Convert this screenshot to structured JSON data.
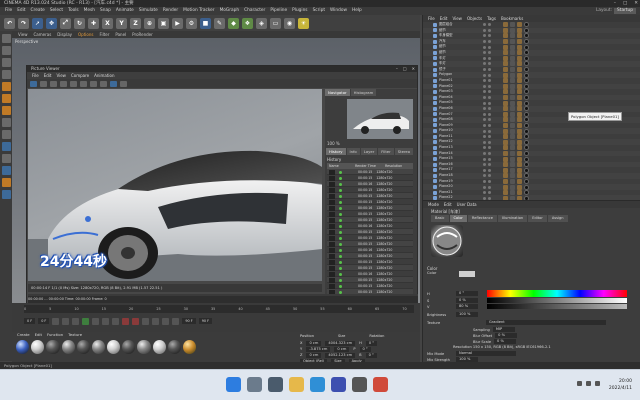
{
  "app": {
    "window_title": "CINEMA 4D R13.024 Studio (RC - R13) - [汽车.c4d *] - 主要"
  },
  "menubar": {
    "items": [
      "File",
      "Edit",
      "Create",
      "Select",
      "Tools",
      "Mesh",
      "Snap",
      "Animate",
      "Simulate",
      "Render",
      "Motion Tracker",
      "MoGraph",
      "Character",
      "Pipeline",
      "Plugins",
      "Script",
      "Window",
      "Help"
    ],
    "layout_label": "Layout:",
    "layout_value": "Startup"
  },
  "toolbar": {
    "buttons": [
      "undo-button",
      "redo-button",
      "live-select-button",
      "move-button",
      "scale-button",
      "rotate-button",
      "recent-button",
      "x-axis-button",
      "y-axis-button",
      "z-axis-button",
      "world-coord-button",
      "render-view-button",
      "render-picture-button",
      "edit-render-settings-button",
      "cube-button",
      "pen-button",
      "subdivision-button",
      "array-button",
      "deformer-button",
      "floor-button",
      "camera-button",
      "light-button"
    ],
    "axis_labels": [
      "X",
      "Y",
      "Z"
    ]
  },
  "viewport": {
    "menu": [
      "View",
      "Cameras",
      "Display",
      "Options",
      "Filter",
      "Panel",
      "ProRender"
    ],
    "active_menu": "Options",
    "label": "Perspective"
  },
  "picture_viewer": {
    "title": "Picture Viewer",
    "menu": [
      "File",
      "Edit",
      "View",
      "Compare",
      "Animation"
    ],
    "timer_overlay": "24分44秒",
    "tabs_top": [
      "Navigator",
      "Histogram"
    ],
    "zoom": "100 %",
    "tabs_history": [
      "History",
      "Info",
      "Layer",
      "Filter",
      "Stereo"
    ],
    "history_label": "History",
    "history_columns": [
      "Name",
      "Render Time",
      "Resolution"
    ],
    "history_rows": [
      {
        "time": "00:00:15",
        "res": "1280x720"
      },
      {
        "time": "00:00:15",
        "res": "1280x720"
      },
      {
        "time": "00:00:16",
        "res": "1280x720"
      },
      {
        "time": "00:00:15",
        "res": "1280x720"
      },
      {
        "time": "00:00:15",
        "res": "1280x720"
      },
      {
        "time": "00:00:15",
        "res": "1280x720"
      },
      {
        "time": "00:00:16",
        "res": "1280x720"
      },
      {
        "time": "00:00:15",
        "res": "1280x720"
      },
      {
        "time": "00:00:15",
        "res": "1280x720"
      },
      {
        "time": "00:00:16",
        "res": "1280x720"
      },
      {
        "time": "00:00:15",
        "res": "1280x720"
      },
      {
        "time": "00:00:15",
        "res": "1280x720"
      },
      {
        "time": "00:00:15",
        "res": "1280x720"
      },
      {
        "time": "00:00:16",
        "res": "1280x720"
      },
      {
        "time": "00:00:15",
        "res": "1280x720"
      },
      {
        "time": "00:00:15",
        "res": "1280x720"
      },
      {
        "time": "00:00:15",
        "res": "1280x720"
      },
      {
        "time": "00:00:16",
        "res": "1280x720"
      },
      {
        "time": "00:00:15",
        "res": "1280x720"
      },
      {
        "time": "00:00:15",
        "res": "1280x720"
      },
      {
        "time": "00:00:15",
        "res": "1280x720"
      },
      {
        "time": "00:00:16",
        "res": "1280x720"
      }
    ],
    "status": "00:00:14 F 1/1 (0 Ms)   Size: 1280x720, RGB (8 Bit), 2.91 MB   (1.57 22.51 )",
    "timeline1": "00:00:00 ... 00:00:00  Time: 00:00:00  Frame: 0",
    "timeline2": "0 F"
  },
  "timeline": {
    "ticks": [
      "0",
      "5",
      "10",
      "15",
      "20",
      "25",
      "30",
      "35",
      "40",
      "45",
      "50",
      "55",
      "60",
      "65",
      "70",
      "75",
      "80",
      "85",
      "90"
    ],
    "start_frame": "0 F",
    "current_frame": "0 F",
    "end_frame": "90 F",
    "max_frame": "90 F"
  },
  "material_manager": {
    "menu": [
      "Create",
      "Edit",
      "Function",
      "Texture"
    ]
  },
  "coordinates": {
    "header": [
      "Position",
      "Size",
      "Rotation"
    ],
    "rows": [
      {
        "axis": "X",
        "pos": "0 cm",
        "size": "4004.323 cm",
        "rot": "H",
        "rot_v": "0 °"
      },
      {
        "axis": "Y",
        "pos": "-3.875 cm",
        "size": "0 cm",
        "rot": "P",
        "rot_v": "0 °"
      },
      {
        "axis": "Z",
        "pos": "0 cm",
        "size": "4052.123 cm",
        "rot": "B",
        "rot_v": "0 °"
      }
    ],
    "mode1": "Object (Rel)",
    "mode2": "Size",
    "apply": "Apply"
  },
  "statusbar": {
    "text": "Polygon Object [Plane01]"
  },
  "object_manager": {
    "menu": [
      "File",
      "Edit",
      "View",
      "Objects",
      "Tags",
      "Bookmarks"
    ],
    "rows": [
      "图层组合",
      "细节",
      "车身模型",
      "汽车",
      "细节",
      "细节",
      "车灯",
      "车灯",
      "镜子",
      "Polygon",
      "Plane01",
      "Plane02",
      "Plane03",
      "Plane04",
      "Plane05",
      "Plane06",
      "Plane07",
      "Plane08",
      "Plane09",
      "Plane10",
      "Plane11",
      "Plane12",
      "Plane13",
      "Plane14",
      "Plane15",
      "Plane16",
      "Plane17",
      "Plane18",
      "Plane19",
      "Plane20",
      "Plane21",
      "Plane22"
    ],
    "tooltip": "Polygon Object [Plane01]"
  },
  "attribute_manager": {
    "menu": [
      "Mode",
      "Edit",
      "User Data"
    ],
    "title": "Material [车漆]",
    "tabs": [
      "Basic",
      "Color",
      "Reflectance",
      "Illumination",
      "Editor",
      "Assign"
    ],
    "active_tab": "Color",
    "section": "Color",
    "fields": [
      {
        "label": "Color",
        "value": ""
      },
      {
        "label": "H",
        "value": "0 °"
      },
      {
        "label": "S",
        "value": "0 %"
      },
      {
        "label": "V",
        "value": "80 %"
      },
      {
        "label": "Brightness",
        "value": "100 %"
      },
      {
        "label": "Texture",
        "value": ""
      },
      {
        "label": "Sampling",
        "value": "MIP"
      },
      {
        "label": "Blur Offset",
        "value": "0 %"
      },
      {
        "label": "Blur Scale",
        "value": "0 %"
      }
    ],
    "texture_name": "Gradient",
    "resolution": "Resolution 150 x 150, RGB (8 Bit), sRGB IEC61966-2.1",
    "mix_mode_label": "Mix Mode",
    "mix_mode": "Normal",
    "mix_strength_label": "Mix Strength",
    "mix_strength": "100 %",
    "model_label": "Model",
    "model": "Lambertian"
  },
  "taskbar": {
    "time": "20:00",
    "date": "2022/4/11"
  }
}
